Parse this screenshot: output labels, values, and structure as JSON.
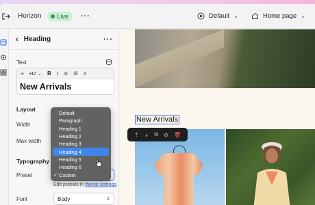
{
  "topbar": {
    "store_name": "Horizon",
    "live_label": "Live",
    "theme_label": "Default",
    "page_label": "Home page"
  },
  "panel": {
    "title": "Heading",
    "text_label": "Text",
    "heading_level": "H2",
    "text_value": "New Arrivals",
    "layout_title": "Layout",
    "width_label": "Width",
    "max_width_label": "Max width",
    "typography_title": "Typography",
    "preset_label": "Preset",
    "preset_help_prefix": "Edit presets in",
    "preset_help_link": "theme settings",
    "preset_help_suffix": ".",
    "font_label": "Font",
    "font_value": "Body"
  },
  "dropdown": {
    "options": [
      "Default",
      "Paragraph",
      "Heading 1",
      "Heading 2",
      "Heading 3",
      "Heading 4",
      "Heading 5",
      "Heading 6",
      "Custom"
    ],
    "highlighted": "Heading 4",
    "checked": "Custom"
  },
  "preview": {
    "heading_text": "New Arrivals"
  },
  "colors": {
    "accent": "#3f86e8",
    "live_bg": "#cdeed6",
    "live_dot": "#2f9c53",
    "delete": "#ff5a5a"
  }
}
